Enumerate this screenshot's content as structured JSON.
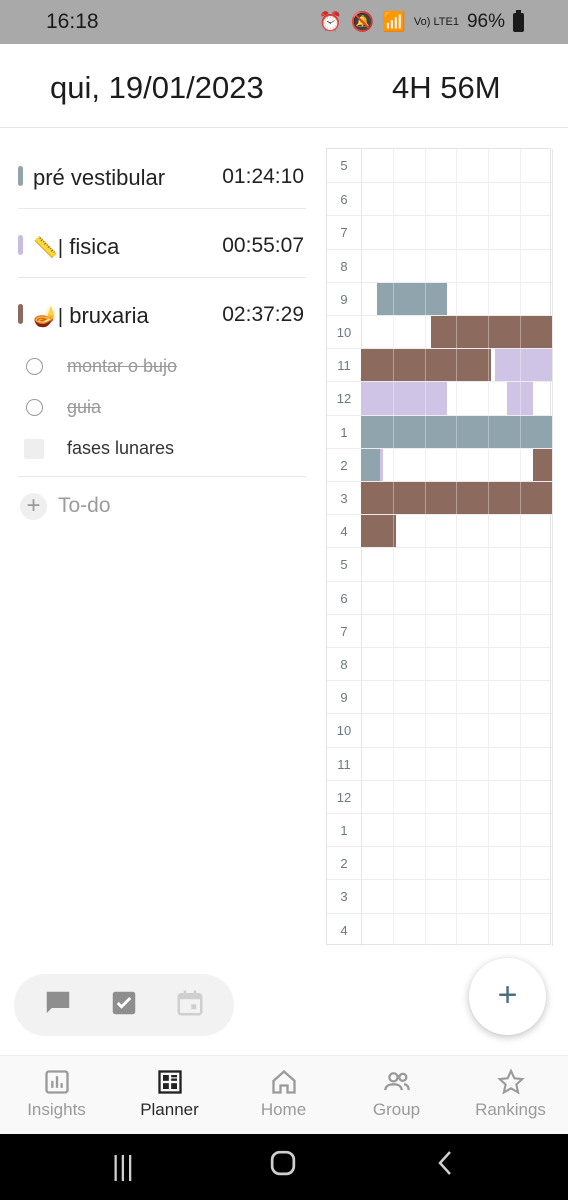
{
  "status": {
    "time": "16:18",
    "battery": "96%",
    "network": "Vo) LTE1"
  },
  "header": {
    "date": "qui, 19/01/2023",
    "total": "4H 56M"
  },
  "subjects": [
    {
      "name": "pré vestibular",
      "emoji": "",
      "time": "01:24:10",
      "color": "#8fa4ad"
    },
    {
      "name": "fisica",
      "emoji": "📏|",
      "time": "00:55:07",
      "color": "#c8bce3"
    },
    {
      "name": "bruxaria",
      "emoji": "🪔|",
      "time": "02:37:29",
      "color": "#8c6a5e"
    }
  ],
  "todos": [
    {
      "text": "montar o bujo",
      "done": true
    },
    {
      "text": "guia",
      "done": true
    },
    {
      "text": "fases lunares",
      "done": false
    }
  ],
  "todo_add_label": "To-do",
  "hours": [
    "5",
    "6",
    "7",
    "8",
    "9",
    "10",
    "11",
    "12",
    "1",
    "2",
    "3",
    "4",
    "5",
    "6",
    "7",
    "8",
    "9",
    "10",
    "11",
    "12",
    "1",
    "2",
    "3",
    "4"
  ],
  "timeline_colors": {
    "gray": "#8fa4ad",
    "lavender": "#cfc3e6",
    "brown": "#8c6a5e"
  },
  "fab_label": "+",
  "mini_toolbar": [
    "chat-icon",
    "checkbox-icon",
    "calendar-icon"
  ],
  "nav": [
    {
      "label": "Insights",
      "icon": "chart-icon"
    },
    {
      "label": "Planner",
      "icon": "planner-icon",
      "active": true
    },
    {
      "label": "Home",
      "icon": "home-icon"
    },
    {
      "label": "Group",
      "icon": "group-icon"
    },
    {
      "label": "Rankings",
      "icon": "star-icon"
    }
  ]
}
